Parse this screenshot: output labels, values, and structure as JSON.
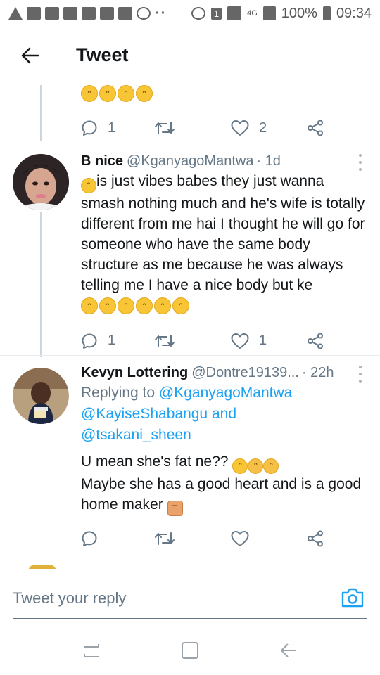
{
  "status_bar": {
    "network": "4G",
    "battery": "100%",
    "time": "09:34",
    "sim": "1"
  },
  "header": {
    "title": "Tweet",
    "back_icon": "arrow-left-icon"
  },
  "tweets": [
    {
      "text_emojis": [
        "rofl",
        "rofl",
        "rofl",
        "rofl"
      ],
      "reply_count": "1",
      "retweet_count": "",
      "like_count": "2"
    },
    {
      "name": "B nice",
      "handle": "@KganyagoMantwa",
      "time": "· 1d",
      "text": "is just vibes babes they just wanna smash nothing much and he's wife is totally different from me hai I thought he will go for someone who have the same body structure as me because he was always telling me I have a nice body but ke",
      "trailing_emojis": [
        "rofl",
        "rofl",
        "rofl",
        "rofl",
        "rofl",
        "rofl"
      ],
      "reply_count": "1",
      "retweet_count": "",
      "like_count": "1"
    },
    {
      "name": "Kevyn Lottering",
      "handle": "@Dontre19139...",
      "time": "· 22h",
      "replying_prefix": "Replying to",
      "replying_to": [
        "@KganyagoMantwa",
        "@KayiseShabangu",
        "@tsakani_sheen"
      ],
      "replying_and": "and",
      "line1": "U mean she's fat ne??",
      "line2": "Maybe she has a good heart and is a good home maker",
      "reply_count": "",
      "retweet_count": "",
      "like_count": ""
    }
  ],
  "composer": {
    "placeholder": "Tweet your reply",
    "camera_icon": "camera-icon"
  },
  "colors": {
    "link": "#1da1f2",
    "muted": "#657786",
    "text": "#14171a",
    "divider": "#e6ecf0"
  }
}
